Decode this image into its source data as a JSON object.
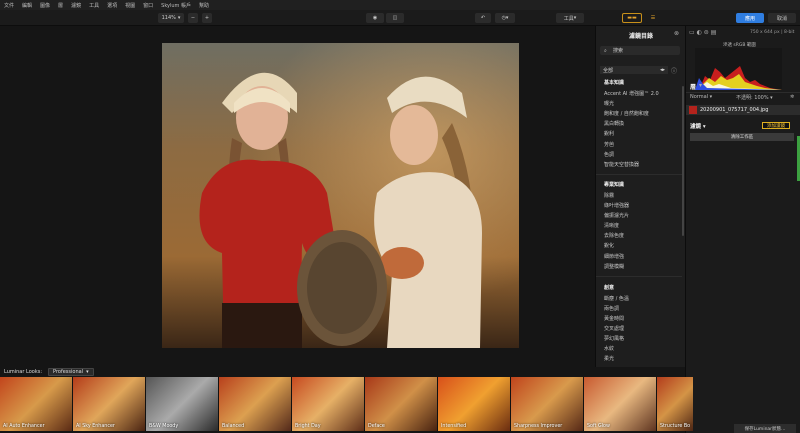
{
  "menu": [
    "文件",
    "編輯",
    "圖像",
    "層",
    "濾鏡",
    "工具",
    "選項",
    "視圖",
    "窗口",
    "Skylum 帳戶",
    "幫助"
  ],
  "toolbar": {
    "zoom": "114%",
    "zoom_minus": "−",
    "zoom_plus": "+",
    "tools": "工具",
    "apply": "應用",
    "cancel": "取消"
  },
  "catalog": {
    "title": "濾鏡目錄",
    "search_placeholder": "搜索",
    "filter_value": "全部",
    "sections": [
      {
        "name": "基本知識",
        "items": [
          "Accent AI 增強圖™ 2.0",
          "曝光",
          "飽和度 / 自然飽和度",
          "黑白轉換",
          "銳利",
          "芳芭",
          "色調",
          "智能天空替換器"
        ]
      },
      {
        "name": "專業知識",
        "items": [
          "除霧",
          "綠叶增強器",
          "偏振濾光片",
          "清晰度",
          "去除色度",
          "銳化",
          "細節增強",
          "調整模糊"
        ]
      },
      {
        "name": "創意",
        "items": [
          "斷塵 / 色溫",
          "兩色調",
          "黃金時間",
          "交叉處理",
          "夢幻風格",
          "水紋",
          "柔光"
        ]
      }
    ]
  },
  "looks": {
    "label": "Luminar Looks:",
    "category": "Professional",
    "items": [
      "AI Auto Enhancer",
      "AI Sky Enhancer",
      "B&W Moody",
      "Balanced",
      "Bright Day",
      "Deface",
      "Intensified",
      "Sharpness Improver",
      "Soft Glow",
      "Structure Bo"
    ]
  },
  "right": {
    "dims": "750 x 644 px | 8-bit",
    "histogram_label": "滲透 sRGB 範圍",
    "layers_label": "層",
    "blend_mode": "Normal",
    "opacity_label": "不透明:",
    "opacity_value": "100%",
    "layer_name": "20200901_075717_004.jpg",
    "filters_label": "濾鏡",
    "add_filter": "添加濾鏡",
    "clear_workspace": "清除工作區",
    "save": "保存Luminar狀態..."
  }
}
